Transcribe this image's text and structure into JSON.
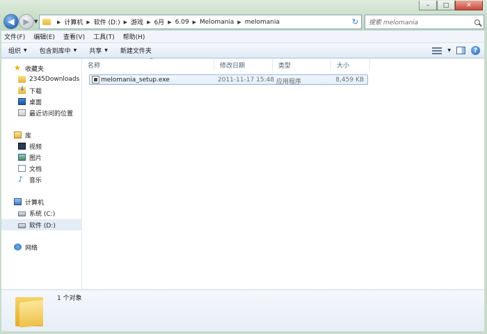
{
  "window": {
    "controls": {
      "minimize": "–",
      "maximize": "□",
      "close": "✕"
    }
  },
  "nav": {
    "back_icon": "back-arrow-icon",
    "forward_icon": "forward-arrow-icon"
  },
  "address": {
    "crumbs": [
      "计算机",
      "软件 (D:)",
      "游戏",
      "6月",
      "6.09",
      "Melomania",
      "melomania"
    ]
  },
  "search": {
    "placeholder": "搜索 melomania"
  },
  "menubar": {
    "items": [
      "文件(F)",
      "编辑(E)",
      "查看(V)",
      "工具(T)",
      "帮助(H)"
    ]
  },
  "toolbar": {
    "organize": "组织",
    "include_in_library": "包含到库中",
    "share": "共享",
    "new_folder": "新建文件夹"
  },
  "sidebar": {
    "favorites": {
      "label": "收藏夹",
      "icon": "star-icon"
    },
    "favorite_items": [
      {
        "label": "2345Downloads",
        "icon": "folder-icon"
      },
      {
        "label": "下载",
        "icon": "download-icon"
      },
      {
        "label": "桌面",
        "icon": "desktop-icon"
      },
      {
        "label": "最近访问的位置",
        "icon": "recent-icon"
      }
    ],
    "libraries": {
      "label": "库",
      "icon": "library-icon"
    },
    "library_items": [
      {
        "label": "视频",
        "icon": "video-icon"
      },
      {
        "label": "图片",
        "icon": "picture-icon"
      },
      {
        "label": "文档",
        "icon": "document-icon"
      },
      {
        "label": "音乐",
        "icon": "music-icon"
      }
    ],
    "computer": {
      "label": "计算机",
      "icon": "computer-icon"
    },
    "computer_items": [
      {
        "label": "系统 (C:)",
        "icon": "drive-icon"
      },
      {
        "label": "软件 (D:)",
        "icon": "drive-icon",
        "selected": true
      }
    ],
    "network": {
      "label": "网络",
      "icon": "network-icon"
    }
  },
  "columns": {
    "name": "名称",
    "date": "修改日期",
    "type": "类型",
    "size": "大小"
  },
  "files": [
    {
      "name": "melomania_setup.exe",
      "date": "2011-11-17 15:48",
      "type": "应用程序",
      "size": "8,459 KB",
      "icon": "exe-icon"
    }
  ],
  "details": {
    "count": "1 个对象",
    "icon": "folder-icon"
  },
  "colors": {
    "accent": "#3a78c3",
    "selection": "#e4ecf6",
    "toolbar": "#dfe9f6"
  }
}
